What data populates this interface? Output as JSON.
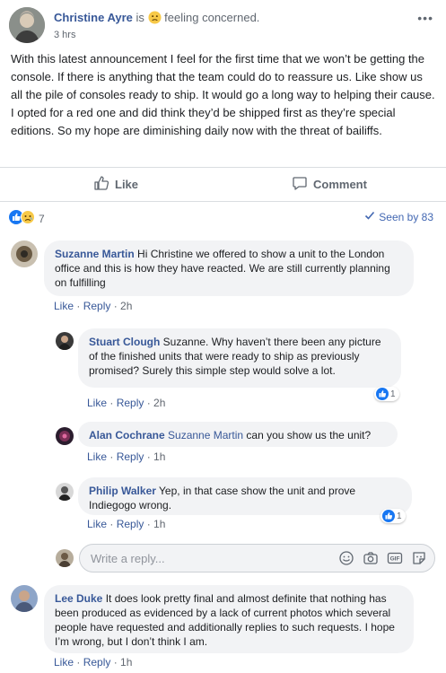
{
  "post": {
    "author": "Christine Ayre",
    "is_word": "is",
    "feeling_text": "feeling concerned.",
    "time": "3 hrs",
    "more_glyph": "•••",
    "text": "With this latest announcement I feel for the first time that we won’t be getting the console. If there is anything that the team could do to reassure us. Like show us all the pile of consoles ready to ship. It would go a long way to helping their cause. I opted for a red one and did think they’d be shipped first as they’re special editions. So my hope are diminishing daily now with the threat of bailiffs."
  },
  "actions": {
    "like": "Like",
    "comment": "Comment"
  },
  "reactions": {
    "count": "7",
    "seen": "Seen by 83",
    "icons": [
      "like-icon",
      "sad-icon"
    ]
  },
  "comments": [
    {
      "name": "Suzanne Martin",
      "text": "Hi Christine we offered to show a unit to the London office and this is how they have reacted. We are still currently planning on fulfilling",
      "like": "Like",
      "reply": "Reply",
      "time": "2h"
    },
    {
      "name": "Stuart Clough",
      "text": "Suzanne. Why haven’t there been any picture of the finished units that were ready to ship as previously promised? Surely this simple step would solve a lot.",
      "like": "Like",
      "reply": "Reply",
      "time": "2h",
      "reaction_count": "1"
    },
    {
      "name": "Alan Cochrane",
      "mention": "Suzanne Martin",
      "text": "can you show us the unit?",
      "like": "Like",
      "reply": "Reply",
      "time": "1h"
    },
    {
      "name": "Philip Walker",
      "text": "Yep, in that case show the unit and prove Indiegogo wrong.",
      "like": "Like",
      "reply": "Reply",
      "time": "1h",
      "reaction_count": "1"
    },
    {
      "name": "Lee Duke",
      "text": "It does look pretty final and almost definite that nothing has been produced as evidenced by a lack of current photos which several people have requested and additionally replies to such requests. I hope I’m wrong, but I don’t think I am.",
      "like": "Like",
      "reply": "Reply",
      "time": "1h"
    }
  ],
  "reply_box": {
    "placeholder": "Write a reply..."
  },
  "colors": {
    "link": "#385898",
    "accent": "#4267b2",
    "bubble": "#f2f3f5",
    "muted": "#606770"
  }
}
